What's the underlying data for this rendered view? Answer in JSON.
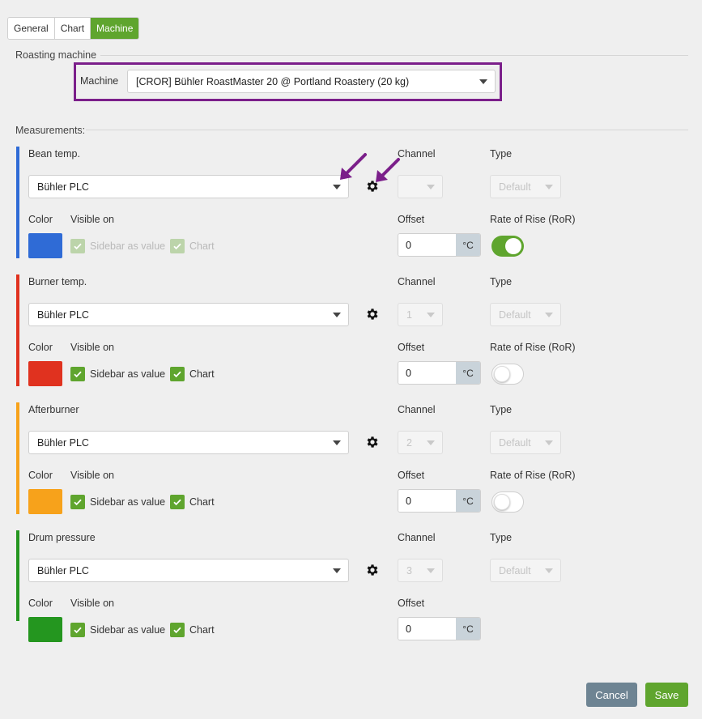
{
  "tabs": [
    {
      "label": "General",
      "active": false
    },
    {
      "label": "Chart",
      "active": false
    },
    {
      "label": "Machine",
      "active": true
    }
  ],
  "roasting_machine": {
    "legend": "Roasting machine",
    "machine_label": "Machine",
    "machine_value": "[CROR] Bühler RoastMaster 20 @ Portland Roastery (20 kg)"
  },
  "measurements_legend": "Measurements:",
  "labels": {
    "channel": "Channel",
    "type": "Type",
    "color": "Color",
    "visible_on": "Visible on",
    "offset": "Offset",
    "ror": "Rate of Rise (RoR)",
    "sidebar": "Sidebar as value",
    "chart": "Chart",
    "unit": "°C"
  },
  "measurements": [
    {
      "name": "Bean temp.",
      "source": "Bühler PLC",
      "channel": "",
      "type": "Default",
      "color": "#2f6bd6",
      "offset": "0",
      "ror": true,
      "checks_disabled": true
    },
    {
      "name": "Burner temp.",
      "source": "Bühler PLC",
      "channel": "1",
      "type": "Default",
      "color": "#e0321f",
      "offset": "0",
      "ror": false,
      "checks_disabled": false
    },
    {
      "name": "Afterburner",
      "source": "Bühler PLC",
      "channel": "2",
      "type": "Default",
      "color": "#f7a21b",
      "offset": "0",
      "ror": false,
      "checks_disabled": false
    },
    {
      "name": "Drum pressure",
      "source": "Bühler PLC",
      "channel": "3",
      "type": "Default",
      "color": "#24961f",
      "offset": "0",
      "ror": null,
      "checks_disabled": false
    }
  ],
  "annotation_color": "#7b1f8a",
  "footer": {
    "cancel": "Cancel",
    "save": "Save"
  }
}
